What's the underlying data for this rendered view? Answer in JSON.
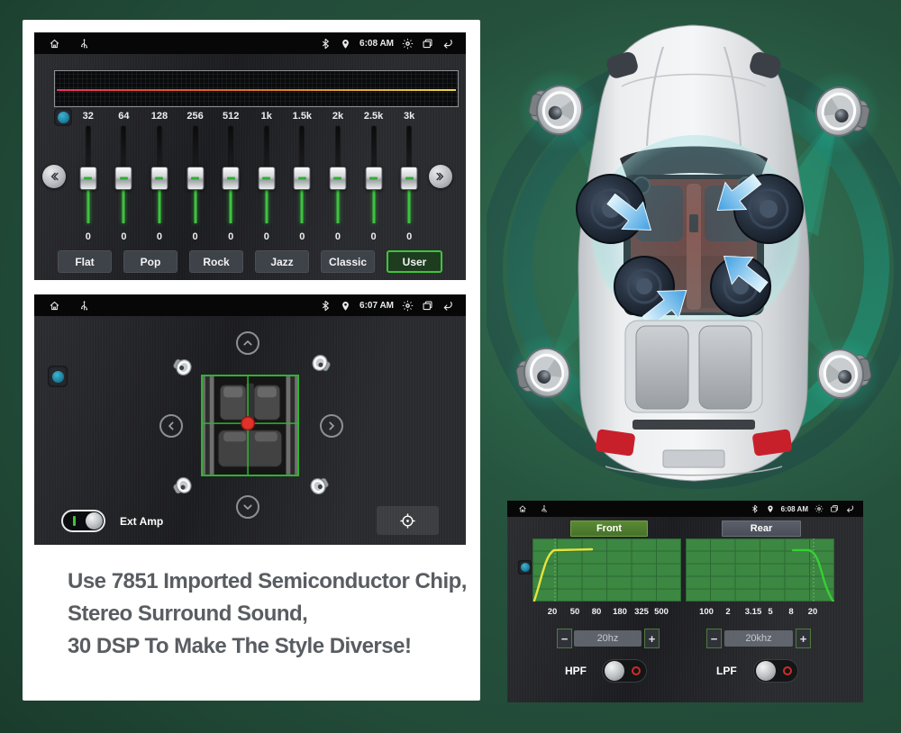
{
  "caption": {
    "line1": "Use 7851 Imported Semiconductor Chip,",
    "line2": "Stereo Surround Sound,",
    "line3": "30 DSP To Make The Style Diverse!"
  },
  "eq_screen": {
    "time": "6:08 AM",
    "frequencies": [
      "32",
      "64",
      "128",
      "256",
      "512",
      "1k",
      "1.5k",
      "2k",
      "2.5k",
      "3k"
    ],
    "values": [
      "0",
      "0",
      "0",
      "0",
      "0",
      "0",
      "0",
      "0",
      "0",
      "0"
    ],
    "presets": [
      "Flat",
      "Pop",
      "Rock",
      "Jazz",
      "Classic",
      "User"
    ],
    "active_preset": "User"
  },
  "balance_screen": {
    "time": "6:07 AM",
    "ext_amp_label": "Ext Amp"
  },
  "xover_screen": {
    "time": "6:08 AM",
    "front_tab": "Front",
    "rear_tab": "Rear",
    "hpf_label": "HPF",
    "lpf_label": "LPF",
    "hpf_value": "20hz",
    "lpf_value": "20khz",
    "minus": "−",
    "plus": "+",
    "hpf_ticks": [
      "20",
      "50",
      "80",
      "180",
      "325",
      "500"
    ],
    "lpf_ticks": [
      "100",
      "2",
      "3.15",
      "5",
      "8",
      "20"
    ]
  },
  "chart_data": [
    {
      "type": "line",
      "title": "Front HPF response",
      "x_ticks": [
        "20",
        "50",
        "80",
        "180",
        "325",
        "500"
      ],
      "line_color": "#e6e33c",
      "points_pct": [
        [
          1,
          98
        ],
        [
          8,
          45
        ],
        [
          15,
          19
        ],
        [
          40,
          17
        ]
      ],
      "grid": "6x5",
      "bg": "#3c8741"
    },
    {
      "type": "line",
      "title": "Rear LPF response",
      "x_ticks": [
        "100",
        "2",
        "3.15",
        "5",
        "8",
        "20"
      ],
      "line_color": "#35d035",
      "points_pct": [
        [
          72,
          18
        ],
        [
          82,
          18
        ],
        [
          93,
          65
        ],
        [
          99,
          99
        ]
      ],
      "grid": "6x5",
      "bg": "#3c8741"
    }
  ]
}
